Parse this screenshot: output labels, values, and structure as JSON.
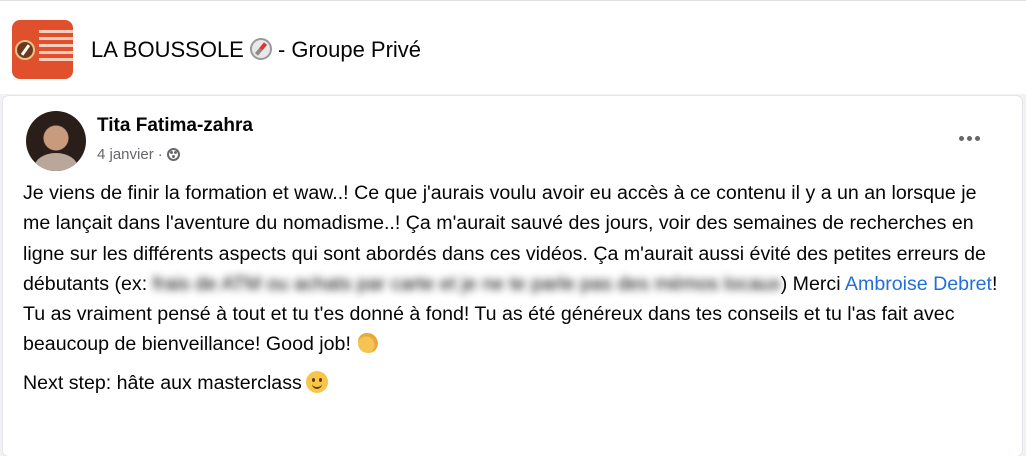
{
  "group": {
    "logo_alt": "LA BOUSSOLE",
    "logo_lines": [
      "LA BOUSSO",
      "LE GUIDE PO",
      "VOYAGER MO",
      "POUR MOINS C",
      "PLUS LONGT"
    ],
    "title": "LA BOUSSOLE",
    "title_suffix": "- Groupe Privé",
    "title_icon": "compass-emoji"
  },
  "post": {
    "author": "Tita Fatima-zahra",
    "date": "4 janvier",
    "separator": "·",
    "audience_icon": "group-members-icon",
    "more_icon": "more-options-icon",
    "paragraph1": {
      "text_before_blur": "Je viens de finir la formation et waw..! Ce que j'aurais voulu avoir eu accès à ce contenu il y a un an lorsque je me lançait dans l'aventure du nomadisme..! Ça m'aurait sauvé des jours, voir des semaines de recherches en ligne sur les différents aspects qui sont abordés dans ces vidéos. Ça m'aurait aussi évité des petites erreurs de débutants (ex:",
      "blurred_text": " frais de ATM ou achats par carte et je ne te parle pas des mémos locaux",
      "text_after_blur": ")  Merci ",
      "mention": "Ambroise Debret",
      "text_after_mention": "!  Tu as vraiment pensé à tout et tu t'es donné à fond! Tu as été généreux dans tes conseils et tu l'as fait avec beaucoup de bienveillance! Good job!",
      "emoji": "clapping-hands-emoji"
    },
    "paragraph2": {
      "text": "Next step: hâte aux masterclass",
      "emoji": "smiling-face-emoji"
    }
  },
  "colors": {
    "link": "#216fdb",
    "logo_bg": "#e0502c",
    "secondary_text": "#65676b"
  }
}
